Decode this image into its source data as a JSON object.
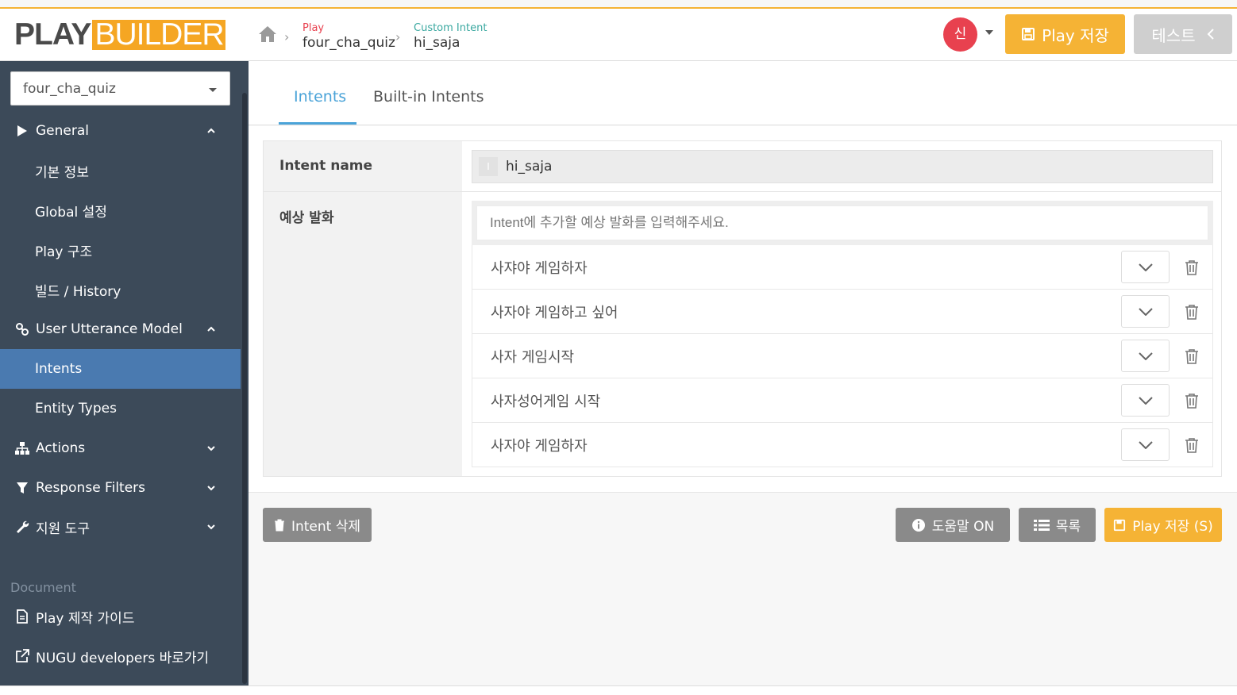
{
  "header": {
    "logo_part1": "PLAY",
    "logo_part2": "BUILDER",
    "breadcrumb": [
      {
        "small": "Play",
        "big": "four_cha_quiz",
        "color": "#e8414f"
      },
      {
        "small": "Custom Intent",
        "big": "hi_saja",
        "color": "#3aa8a0"
      }
    ],
    "avatar_initial": "신",
    "save_button": "Play 저장",
    "test_button": "테스트"
  },
  "sidebar": {
    "play_select_value": "four_cha_quiz",
    "items": [
      {
        "label": "General",
        "icon": "play-triangle-icon"
      },
      {
        "label": "기본 정보"
      },
      {
        "label": "Global 설정"
      },
      {
        "label": "Play 구조"
      },
      {
        "label": "빌드 / History"
      },
      {
        "label": "User Utterance Model",
        "icon": "link-icon"
      },
      {
        "label": "Intents"
      },
      {
        "label": "Entity Types"
      },
      {
        "label": "Actions",
        "icon": "sitemap-icon"
      },
      {
        "label": "Response Filters",
        "icon": "filter-icon"
      },
      {
        "label": "지원 도구",
        "icon": "wrench-icon"
      }
    ],
    "document_label": "Document",
    "doc_items": [
      {
        "label": "Play 제작 가이드",
        "icon": "file-icon"
      },
      {
        "label": "NUGU developers 바로가기",
        "icon": "external-link-icon"
      }
    ]
  },
  "main": {
    "tabs": [
      {
        "label": "Intents"
      },
      {
        "label": "Built-in Intents"
      }
    ],
    "intent_name_label": "Intent name",
    "intent_name_value": "hi_saja",
    "utterance_label": "예상 발화",
    "utterance_placeholder": "Intent에 추가할 예상 발화를 입력해주세요.",
    "utterances": [
      "사쟈야 게임하자",
      "사자야 게임하고 싶어",
      "사자 게임시작",
      "사자성어게임 시작",
      "사자야 게임하자"
    ]
  },
  "actions": {
    "delete_button": "Intent 삭제",
    "help_button": "도움말 ON",
    "list_button": "목록",
    "save_button": "Play 저장 (S)"
  },
  "colors": {
    "accent_orange": "#f5b335",
    "sidebar_bg": "#3c4a59",
    "sidebar_active": "#4a7ab0",
    "tab_active": "#4aa3d8",
    "avatar": "#e8414f"
  }
}
